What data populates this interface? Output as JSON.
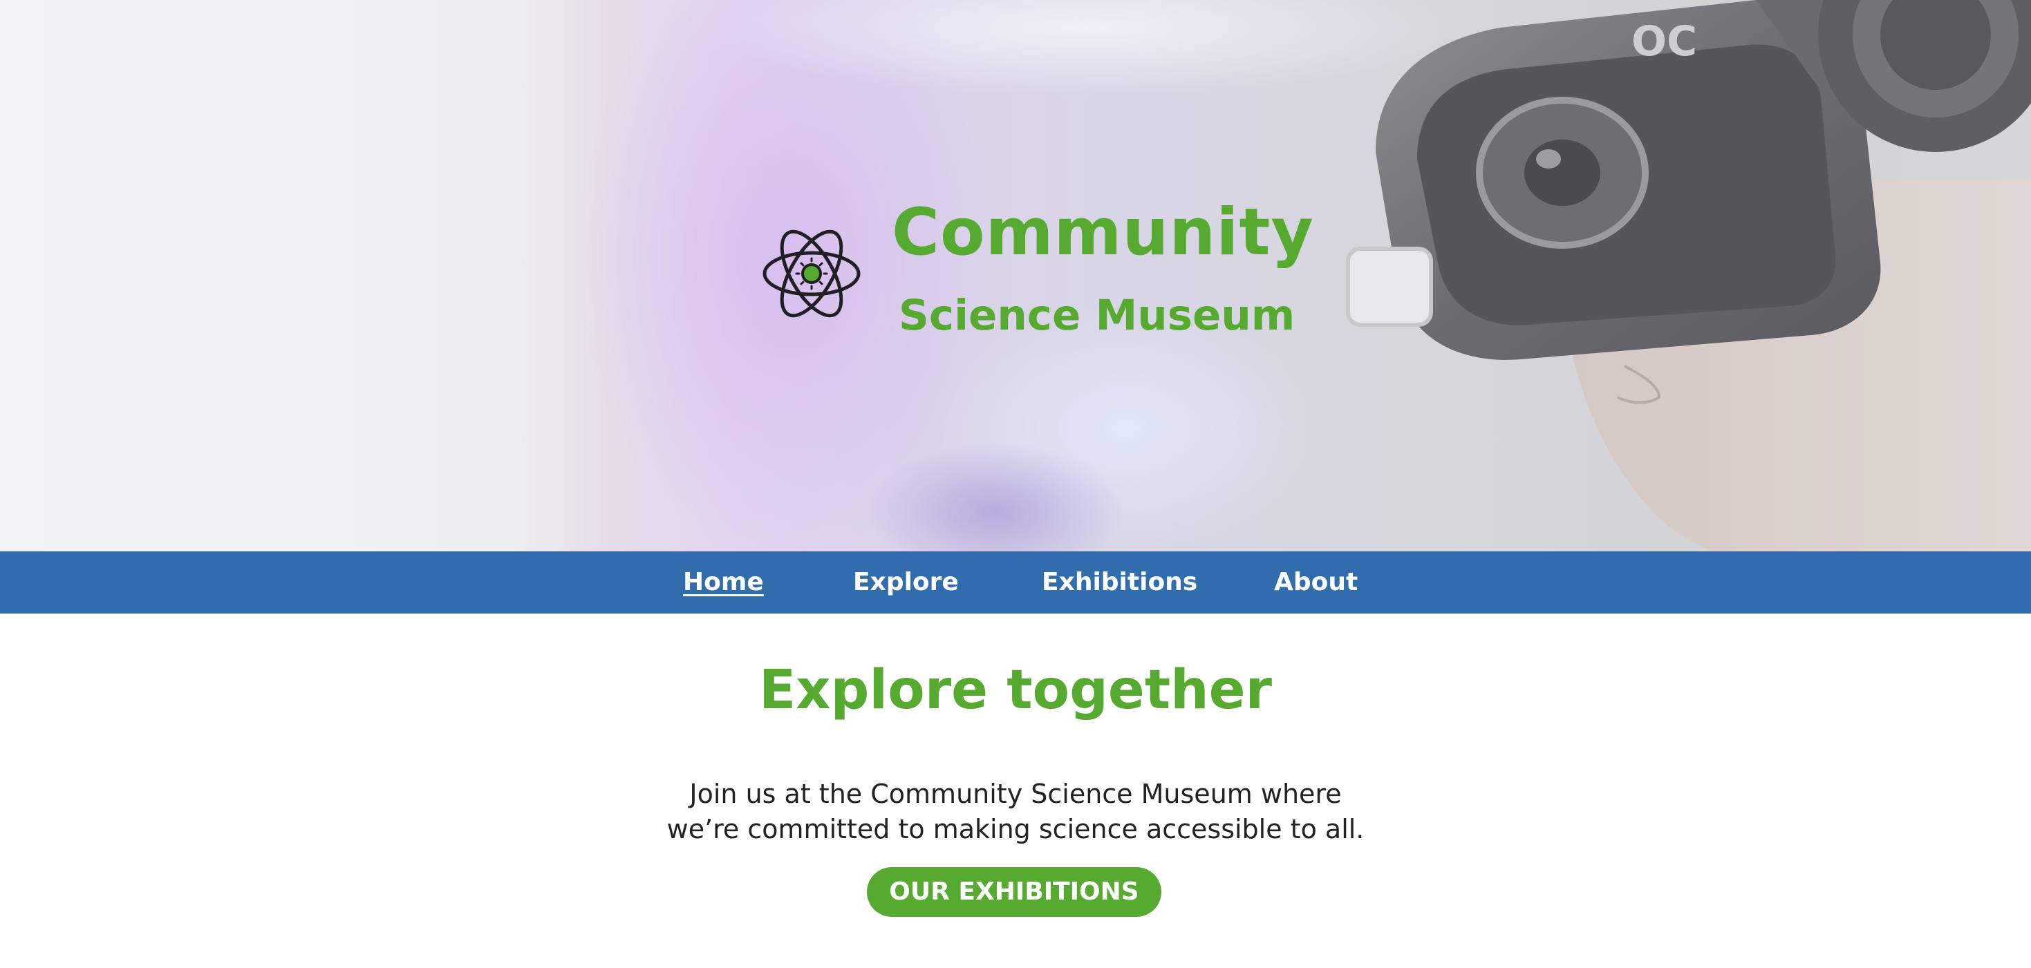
{
  "hero": {
    "title_line1": "Community",
    "title_line2": "Science Museum",
    "logo_icon": "atom-icon",
    "background_image": "person-wearing-vr-headset"
  },
  "nav": {
    "items": [
      {
        "label": "Home",
        "active": true
      },
      {
        "label": "Explore",
        "active": false
      },
      {
        "label": "Exhibitions",
        "active": false
      },
      {
        "label": "About",
        "active": false
      }
    ]
  },
  "main": {
    "headline": "Explore together",
    "intro_line1": "Join us at the Community Science Museum where",
    "intro_line2": "we’re committed to making science accessible to all.",
    "cta_label": "OUR EXHIBITIONS"
  },
  "colors": {
    "brand_green": "#55aa2f",
    "nav_blue": "#316dad",
    "text": "#222222"
  }
}
